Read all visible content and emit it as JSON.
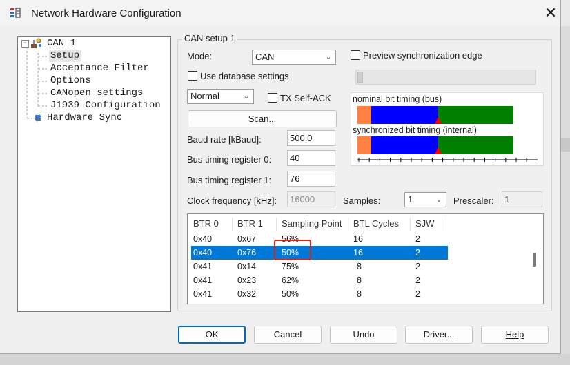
{
  "window": {
    "title": "Network Hardware Configuration",
    "close_glyph": "✕"
  },
  "tree": {
    "items": [
      {
        "label": "CAN 1"
      },
      {
        "label": "Setup"
      },
      {
        "label": "Acceptance Filter"
      },
      {
        "label": "Options"
      },
      {
        "label": "CANopen settings"
      },
      {
        "label": "J1939 Configuration"
      },
      {
        "label": "Hardware Sync"
      }
    ],
    "expander": "⊟"
  },
  "setup": {
    "group_title": "CAN setup 1",
    "mode_label": "Mode:",
    "mode_value": "CAN",
    "use_db_label": "Use database settings",
    "normal_value": "Normal",
    "tx_self_ack_label": "TX Self-ACK",
    "scan_label": "Scan...",
    "baud_label": "Baud rate [kBaud]:",
    "baud_value": "500.0",
    "btr0_label": "Bus timing register 0:",
    "btr0_value": "40",
    "btr1_label": "Bus timing register 1:",
    "btr1_value": "76",
    "clock_label": "Clock frequency [kHz]:",
    "clock_value": "16000",
    "samples_label": "Samples:",
    "samples_value": "1",
    "prescaler_label": "Prescaler:",
    "prescaler_value": "1",
    "preview_label": "Preview synchronization edge"
  },
  "timing": {
    "nominal_label": "nominal bit timing (bus)",
    "sync_label": "synchronized bit timing (internal)",
    "colors": {
      "sync": "#ff8040",
      "prop": "#0000ff",
      "phase2": "#008000",
      "sample_marker": "#ff0000"
    }
  },
  "table": {
    "headers": [
      "BTR 0",
      "BTR 1",
      "Sampling Point",
      "BTL Cycles",
      "SJW"
    ],
    "rows": [
      [
        "0x40",
        "0x67",
        "56%",
        "16",
        "2"
      ],
      [
        "0x40",
        "0x76",
        "50%",
        "16",
        "2"
      ],
      [
        "0x41",
        "0x14",
        "75%",
        "8",
        "2"
      ],
      [
        "0x41",
        "0x23",
        "62%",
        "8",
        "2"
      ],
      [
        "0x41",
        "0x32",
        "50%",
        "8",
        "2"
      ]
    ],
    "selected_row": 1
  },
  "buttons": {
    "ok": "OK",
    "cancel": "Cancel",
    "undo": "Undo",
    "driver": "Driver...",
    "help": "Help"
  }
}
